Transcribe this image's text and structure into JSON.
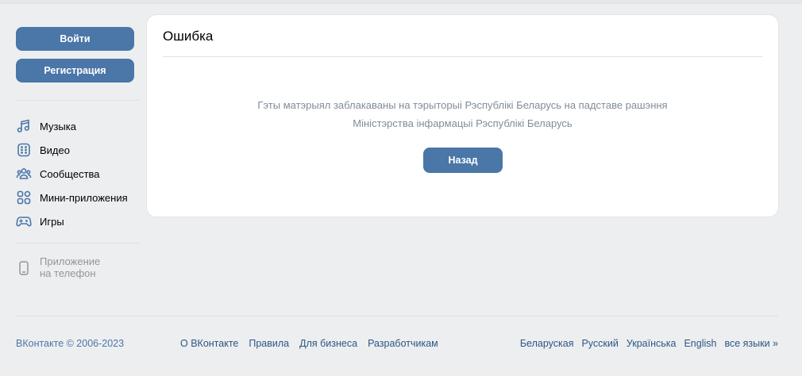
{
  "sidebar": {
    "login_label": "Войти",
    "register_label": "Регистрация",
    "items": [
      {
        "label": "Музыка",
        "icon": "music-icon"
      },
      {
        "label": "Видео",
        "icon": "video-icon"
      },
      {
        "label": "Сообщества",
        "icon": "communities-icon"
      },
      {
        "label": "Мини-приложения",
        "icon": "mini-apps-icon"
      },
      {
        "label": "Игры",
        "icon": "gamepad-icon"
      }
    ],
    "phone_app": {
      "line1": "Приложение",
      "line2": "на телефон",
      "icon": "phone-icon"
    }
  },
  "card": {
    "title": "Ошибка",
    "message_line1": "Гэты матэрыял заблакаваны на тэрыторыі Рэспублікі Беларусь на падставе рашэння",
    "message_line2": "Міністэрства інфармацыі Рэспублікі Беларусь",
    "back_label": "Назад"
  },
  "footer": {
    "copyright": "ВКонтакте © 2006-2023",
    "links": [
      "О ВКонтакте",
      "Правила",
      "Для бизнеса",
      "Разработчикам"
    ],
    "languages": [
      "Беларуская",
      "Русский",
      "Українська",
      "English",
      "все языки »"
    ]
  },
  "colors": {
    "accent": "#4a76a8",
    "link": "#2a5885",
    "background": "#edeef0",
    "muted_text": "#818c99"
  }
}
